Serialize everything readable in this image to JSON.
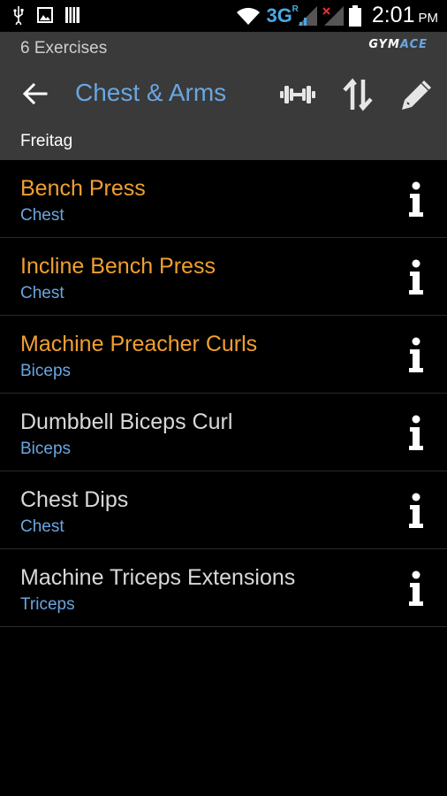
{
  "status_bar": {
    "network": "3G",
    "network_sup": "R",
    "time": "2:01",
    "ampm": "PM"
  },
  "header": {
    "subtitle": "6 Exercises",
    "brand_part1": "GYM",
    "brand_part2": "ACE",
    "title": "Chest & Arms",
    "day_label": "Freitag"
  },
  "colors": {
    "accent_blue": "#6aa6e0",
    "highlight_orange": "#f0a030",
    "normal_text": "#d8d8d8"
  },
  "exercises": [
    {
      "name": "Bench Press",
      "muscle": "Chest",
      "highlighted": true
    },
    {
      "name": "Incline Bench Press",
      "muscle": "Chest",
      "highlighted": true
    },
    {
      "name": "Machine Preacher Curls",
      "muscle": "Biceps",
      "highlighted": true
    },
    {
      "name": "Dumbbell Biceps Curl",
      "muscle": "Biceps",
      "highlighted": false
    },
    {
      "name": "Chest Dips",
      "muscle": "Chest",
      "highlighted": false
    },
    {
      "name": "Machine Triceps Extensions",
      "muscle": "Triceps",
      "highlighted": false
    }
  ],
  "icons": {
    "back": "arrow-left-icon",
    "dumbbell": "dumbbell-icon",
    "sort": "sort-icon",
    "edit": "pencil-icon",
    "info": "info-icon"
  }
}
